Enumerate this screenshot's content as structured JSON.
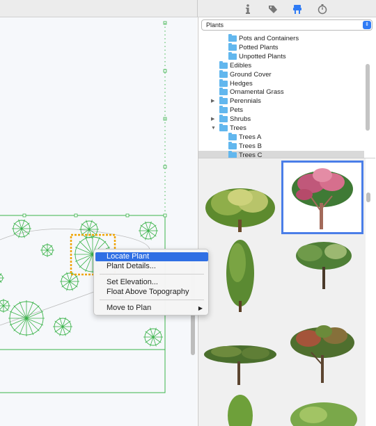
{
  "toolbar": {
    "icons": [
      {
        "name": "info-icon",
        "glyph": "ℹ"
      },
      {
        "name": "tag-icon",
        "glyph": "◆"
      },
      {
        "name": "plant-library-icon",
        "glyph": "⛊"
      },
      {
        "name": "stopwatch-icon",
        "glyph": "⏱"
      }
    ],
    "active_color": "#2f7bf5"
  },
  "library": {
    "category_select": "Plants",
    "tree": [
      {
        "label": "Pots and Containers",
        "level": 2,
        "disclosure": ""
      },
      {
        "label": "Potted Plants",
        "level": 2,
        "disclosure": ""
      },
      {
        "label": "Unpotted Plants",
        "level": 2,
        "disclosure": ""
      },
      {
        "label": "Edibles",
        "level": 1,
        "disclosure": ""
      },
      {
        "label": "Ground Cover",
        "level": 1,
        "disclosure": ""
      },
      {
        "label": "Hedges",
        "level": 1,
        "disclosure": ""
      },
      {
        "label": "Ornamental Grass",
        "level": 1,
        "disclosure": ""
      },
      {
        "label": "Perennials",
        "level": 1,
        "disclosure": "▶"
      },
      {
        "label": "Pets",
        "level": 1,
        "disclosure": ""
      },
      {
        "label": "Shrubs",
        "level": 1,
        "disclosure": "▶"
      },
      {
        "label": "Trees",
        "level": 1,
        "disclosure": "▼"
      },
      {
        "label": "Trees A",
        "level": 2,
        "disclosure": ""
      },
      {
        "label": "Trees B",
        "level": 2,
        "disclosure": ""
      },
      {
        "label": "Trees C",
        "level": 2,
        "disclosure": "",
        "selected": true
      }
    ],
    "folder_color": "#62b7ee",
    "selection_color": "#4a7ee8"
  },
  "context_menu": {
    "items": [
      {
        "label": "Locate Plant",
        "highlighted": true
      },
      {
        "label": "Plant Details..."
      },
      {
        "label": "Set Elevation..."
      },
      {
        "label": "Float Above Topography"
      },
      {
        "label": "Move to Plan",
        "submenu": "▶"
      }
    ],
    "highlight_color": "#2f6fe4"
  },
  "plan": {
    "line_color": "#3bb34a",
    "selection_color": "#f0a400"
  }
}
